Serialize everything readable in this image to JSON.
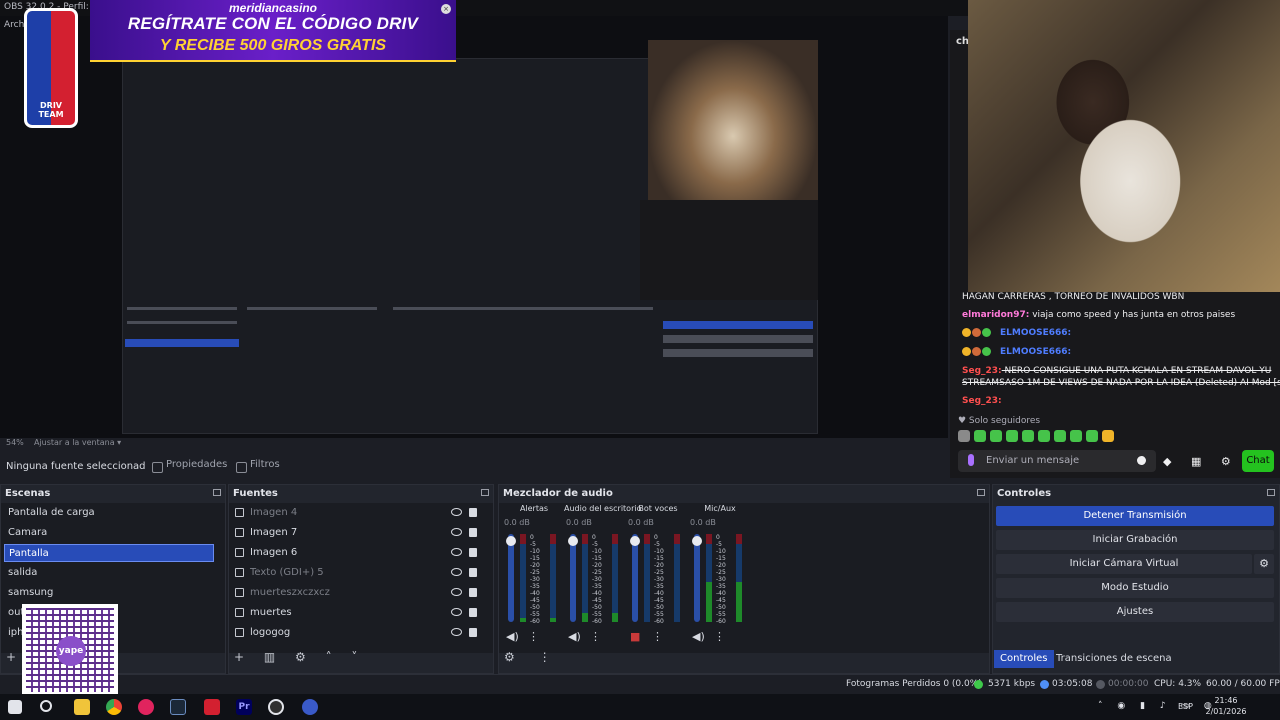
{
  "window": {
    "title": "OBS 32.0.2 - Perfil: Sin",
    "menu_first": "Arch"
  },
  "banner": {
    "brand": "meridiancasino",
    "line1": "REGÍTRATE CON EL CÓDIGO  DRIV",
    "line2": "Y RECIBE 500 GIROS GRATIS",
    "close_symbol": "×"
  },
  "logo": {
    "text": "DRIV TEAM"
  },
  "chat": {
    "header": "ch",
    "messages": [
      {
        "user": "",
        "text": "HAGAN CARRERAS , TORNEO DE INVALIDOS WBN",
        "user_color": "#efeff1"
      },
      {
        "user": "elmaridon97:",
        "text": " viaja como speed y has junta en otros paises",
        "user_color": "#ff7ad9"
      },
      {
        "user": "ELMOOSE666:",
        "text": "",
        "user_color": "#4f7dff"
      },
      {
        "user": "ELMOOSE666:",
        "text": "",
        "user_color": "#4f7dff"
      },
      {
        "user": "Seg_23:",
        "text": " NERO CONSIGUE UNA PUTA KCHALA EN STREAM DAVOL YU",
        "user_color": "#ff4f4f"
      },
      {
        "user": "",
        "text": "STREAMSASO 1M DE VIEWS DE NADA POR LA IDEA (Deleted) AI Mod [sexual]",
        "user_color": "#efeff1"
      },
      {
        "user": "Seg_23:",
        "text": "",
        "user_color": "#ff4f4f"
      }
    ],
    "followers_only": "♥ Solo seguidores",
    "input_placeholder": "Enviar un mensaje",
    "send_label": "Chat"
  },
  "zoom": {
    "label": "54%",
    "fit_label": "Ajustar a la ventana"
  },
  "source_bar": {
    "no_source": "Ninguna fuente seleccionad",
    "properties": "Propiedades",
    "filters": "Filtros"
  },
  "scenes": {
    "title": "Escenas",
    "items": [
      "Pantalla de carga",
      "Camara",
      "Pantalla",
      "salida",
      "samsung",
      "out",
      "iphe"
    ],
    "active_index": 2
  },
  "sources": {
    "title": "Fuentes",
    "items": [
      {
        "label": "Imagen 4",
        "dim": true
      },
      {
        "label": "Imagen 7",
        "dim": false
      },
      {
        "label": "Imagen 6",
        "dim": false
      },
      {
        "label": "Texto (GDI+) 5",
        "dim": true
      },
      {
        "label": "muerteszxczxcz",
        "dim": true
      },
      {
        "label": "muertes",
        "dim": false
      },
      {
        "label": "logogog",
        "dim": false
      }
    ]
  },
  "mixer": {
    "title": "Mezclador de audio",
    "channels": [
      {
        "name": "Alertas",
        "db": "0.0 dB",
        "level": 0.05,
        "muted": false
      },
      {
        "name": "Audio del escritorio",
        "db": "0.0 dB",
        "level": 0.1,
        "muted": false
      },
      {
        "name": "Bot voces",
        "db": "0.0 dB",
        "level": 0.0,
        "muted": true
      },
      {
        "name": "Mic/Aux",
        "db": "0.0 dB",
        "level": 0.45,
        "muted": false
      }
    ],
    "scale": [
      "0",
      "-5",
      "-10",
      "-15",
      "-20",
      "-25",
      "-30",
      "-35",
      "-40",
      "-45",
      "-50",
      "-55",
      "-60"
    ]
  },
  "controls": {
    "title": "Controles",
    "stop_stream": "Detener Transmisión",
    "start_recording": "Iniciar Grabación",
    "start_virtual_cam": "Iniciar Cámara Virtual",
    "studio_mode": "Modo Estudio",
    "settings": "Ajustes",
    "tab_controls": "Controles",
    "tab_transitions": "Transiciones de escena"
  },
  "status": {
    "dropped_frames": "Fotogramas Perdidos 0 (0.0%)",
    "bitrate": "5371 kbps",
    "stream_time": "03:05:08",
    "record_time": "00:00:00",
    "cpu": "CPU: 4.3%",
    "fps": "60.00 / 60.00 FPS"
  },
  "qr": {
    "label": "yape"
  },
  "taskbar": {
    "lang": "ESP",
    "time": "21:46",
    "date": "2/01/2026"
  }
}
